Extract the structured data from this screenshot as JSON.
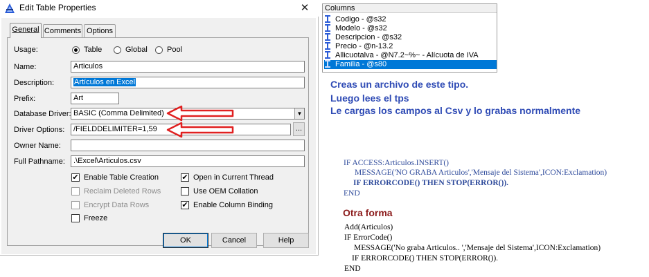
{
  "dialog": {
    "title": "Edit Table Properties",
    "close_glyph": "✕",
    "tabs": [
      {
        "label": "General",
        "active": true
      },
      {
        "label": "Comments",
        "active": false
      },
      {
        "label": "Options",
        "active": false
      }
    ],
    "usage": {
      "label": "Usage:",
      "options": [
        {
          "label": "Table",
          "selected": true
        },
        {
          "label": "Global",
          "selected": false
        },
        {
          "label": "Pool",
          "selected": false
        }
      ]
    },
    "name": {
      "label": "Name:",
      "value": "Articulos"
    },
    "description": {
      "label": "Description:",
      "value": "Artículos en Excel"
    },
    "prefix": {
      "label": "Prefix:",
      "value": "Art"
    },
    "database_driver": {
      "label": "Database Driver:",
      "value": "BASIC (Comma Delimited)"
    },
    "driver_options": {
      "label": "Driver Options:",
      "value": "/FIELDDELIMITER=1,59",
      "button": "..."
    },
    "owner_name": {
      "label": "Owner Name:",
      "value": ""
    },
    "full_pathname": {
      "label": "Full Pathname:",
      "value": ".\\Excel\\Articulos.csv"
    },
    "checkboxes_left": [
      {
        "label": "Enable Table Creation",
        "checked": true,
        "enabled": true
      },
      {
        "label": "Reclaim Deleted Rows",
        "checked": false,
        "enabled": false
      },
      {
        "label": "Encrypt Data Rows",
        "checked": false,
        "enabled": false
      },
      {
        "label": "Freeze",
        "checked": false,
        "enabled": true
      }
    ],
    "checkboxes_right": [
      {
        "label": "Open in Current Thread",
        "checked": true,
        "enabled": true
      },
      {
        "label": "Use OEM Collation",
        "checked": false,
        "enabled": true
      },
      {
        "label": "Enable Column Binding",
        "checked": true,
        "enabled": true
      }
    ],
    "buttons": {
      "ok": "OK",
      "cancel": "Cancel",
      "help": "Help"
    },
    "check_glyph": "✔",
    "arrow_color": "#e02020"
  },
  "columns_panel": {
    "header": "Columns",
    "items": [
      {
        "label": "Codigo - @s32",
        "selected": false
      },
      {
        "label": "Modelo - @s32",
        "selected": false
      },
      {
        "label": "Descripcion - @s32",
        "selected": false
      },
      {
        "label": "Precio - @n-13.2",
        "selected": false
      },
      {
        "label": "Allicuotalva - @N7.2~%~ - Alícuota de IVA",
        "selected": false
      },
      {
        "label": "Familia - @s80",
        "selected": true
      }
    ]
  },
  "notes": {
    "lines": [
      "Creas un archivo de este tipo.",
      "Luego lees el tps",
      "Le cargas los campos al Csv y lo grabas normalmente"
    ],
    "color": "#2f4bb5"
  },
  "code1": [
    "IF  ACCESS:Articulos.INSERT()",
    "MESSAGE('NO GRABA Articulos','Mensaje del Sistema',ICON:Exclamation)",
    "IF ERRORCODE() THEN STOP(ERROR()).",
    "END"
  ],
  "otra_forma": {
    "label": "Otra forma",
    "color": "#8b1a1a"
  },
  "code2": [
    "Add(Articulos)",
    "IF  ErrorCode()",
    "MESSAGE('No graba Articulos..  ','Mensaje del Sistema',ICON:Exclamation)",
    "IF ERRORCODE() THEN STOP(ERROR()).",
    "END"
  ]
}
